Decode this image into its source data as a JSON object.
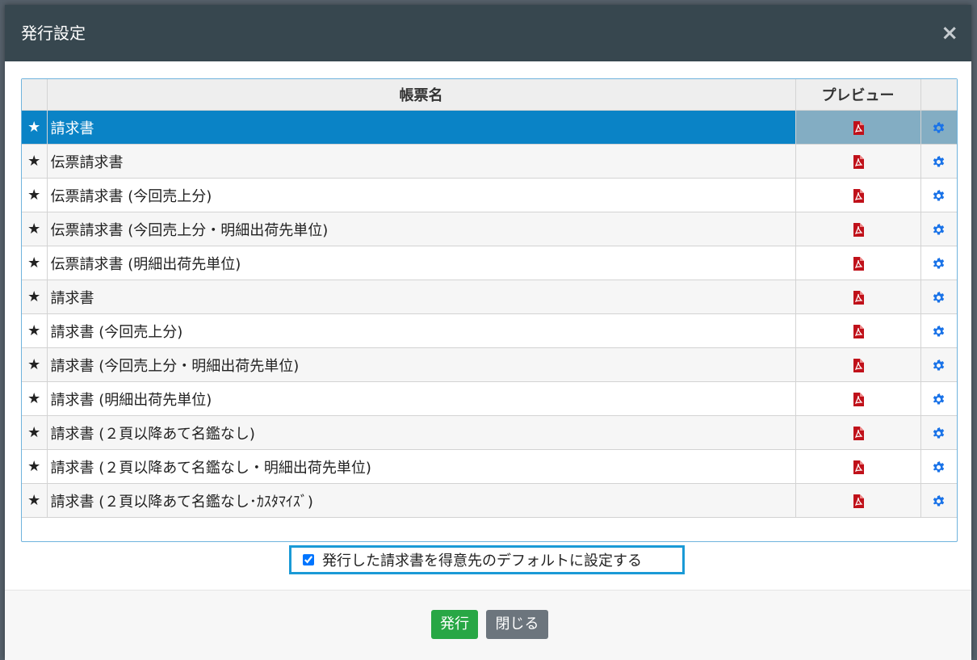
{
  "dialog": {
    "title": "発行設定",
    "close_label": "×"
  },
  "table": {
    "headers": [
      "",
      "帳票名",
      "プレビュー",
      ""
    ],
    "rows": [
      {
        "name": "請求書",
        "selected": true
      },
      {
        "name": "伝票請求書",
        "selected": false
      },
      {
        "name": "伝票請求書 (今回売上分)",
        "selected": false
      },
      {
        "name": "伝票請求書 (今回売上分・明細出荷先単位)",
        "selected": false
      },
      {
        "name": "伝票請求書 (明細出荷先単位)",
        "selected": false
      },
      {
        "name": "請求書",
        "selected": false
      },
      {
        "name": "請求書 (今回売上分)",
        "selected": false
      },
      {
        "name": "請求書 (今回売上分・明細出荷先単位)",
        "selected": false
      },
      {
        "name": "請求書 (明細出荷先単位)",
        "selected": false
      },
      {
        "name": "請求書 (２頁以降あて名鑑なし)",
        "selected": false
      },
      {
        "name": "請求書 (２頁以降あて名鑑なし・明細出荷先単位)",
        "selected": false
      },
      {
        "name": "請求書 (２頁以降あて名鑑なし･ｶｽﾀﾏｲｽﾞ)",
        "selected": false
      }
    ],
    "star_glyph": "★",
    "icons": {
      "row_star": "star-icon",
      "preview": "pdf-icon",
      "settings": "gear-icon"
    }
  },
  "default_option": {
    "label": "発行した請求書を得意先のデフォルトに設定する",
    "checked": true
  },
  "footer": {
    "issue_label": "発行",
    "close_label": "閉じる"
  },
  "colors": {
    "header_bg": "#37474f",
    "selected_row": "#0a83c6",
    "issue_button": "#28a745",
    "close_button": "#6c757d",
    "pdf_icon": "#c0111a",
    "gear_icon": "#1a73e8"
  }
}
